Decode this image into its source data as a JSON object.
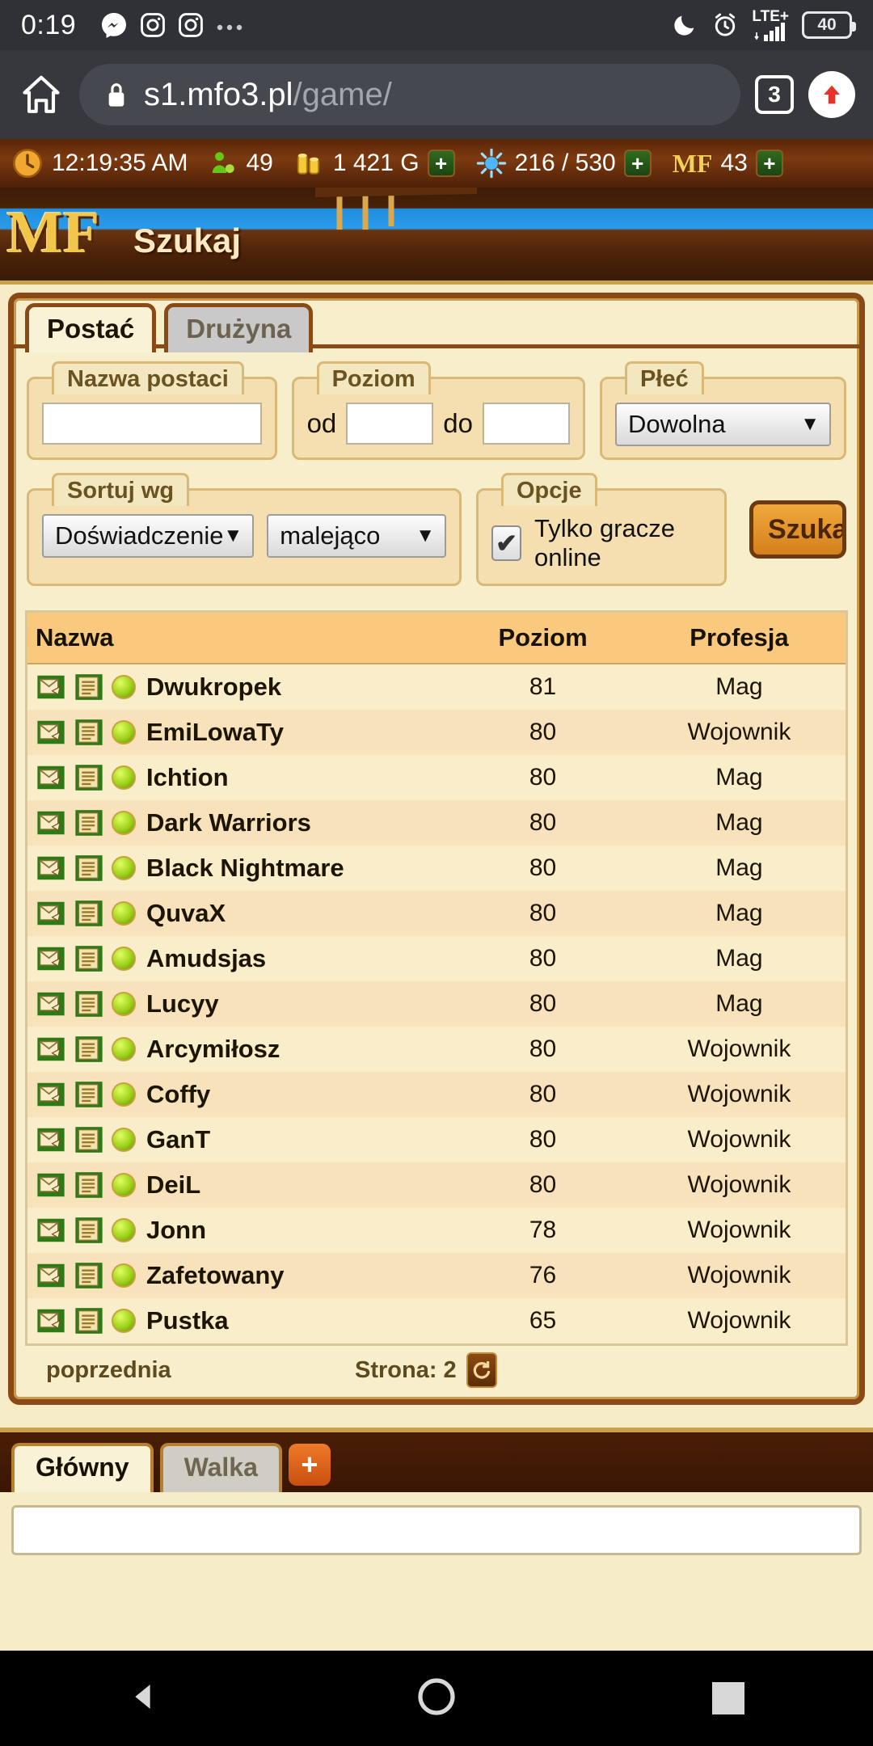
{
  "status_bar": {
    "clock": "0:19",
    "left_icons": [
      "messenger-icon",
      "instagram-icon",
      "instagram-icon",
      "overflow-dots-icon"
    ],
    "right_icons": [
      "moon-icon",
      "alarm-icon",
      "signal-icon"
    ],
    "network_label": "LTE+",
    "battery_level": "40"
  },
  "browser": {
    "home_icon": "home-icon",
    "lock_icon": "lock-icon",
    "url_domain": "s1.mfo3.pl",
    "url_path": "/game/",
    "tab_count": "3",
    "scroll_top_icon": "arrow-up-icon"
  },
  "resource_bar": {
    "clock_icon": "clock-icon",
    "game_time": "12:19:35 AM",
    "online_icon": "players-online-icon",
    "online_count": "49",
    "gold_icon": "gold-coins-icon",
    "gold": "1 421 G",
    "energy_icon": "energy-icon",
    "energy": "216 / 530",
    "mf_label": "MF",
    "mf_value": "43",
    "plus_label": "+"
  },
  "banner": {
    "logo": "MF",
    "title": "Szukaj"
  },
  "search_panel": {
    "tabs": [
      {
        "label": "Postać",
        "active": true
      },
      {
        "label": "Drużyna",
        "active": false
      }
    ],
    "name_field": {
      "legend": "Nazwa postaci",
      "value": "",
      "placeholder": ""
    },
    "level_field": {
      "legend": "Poziom",
      "from_label": "od",
      "from_value": "",
      "to_label": "do",
      "to_value": ""
    },
    "gender_field": {
      "legend": "Płeć",
      "selected": "Dowolna",
      "caret": "▼"
    },
    "sort_field": {
      "legend": "Sortuj wg",
      "by_selected": "Doświadczenie",
      "dir_selected": "malejąco",
      "caret": "▼"
    },
    "options_field": {
      "legend": "Opcje",
      "checkbox_label": "Tylko gracze online",
      "checkbox_checked": true,
      "check_glyph": "✔"
    },
    "search_button": "Szukaj"
  },
  "results": {
    "columns": [
      "Nazwa",
      "Poziom",
      "Profesja"
    ],
    "row_icons": [
      "mail-icon",
      "profile-icon",
      "online-dot-icon"
    ],
    "rows": [
      {
        "name": "Dwukropek",
        "level": "81",
        "profession": "Mag"
      },
      {
        "name": "EmiLowaTy",
        "level": "80",
        "profession": "Wojownik"
      },
      {
        "name": "Ichtion",
        "level": "80",
        "profession": "Mag"
      },
      {
        "name": "Dark Warriors",
        "level": "80",
        "profession": "Mag"
      },
      {
        "name": "Black Nightmare",
        "level": "80",
        "profession": "Mag"
      },
      {
        "name": "QuvaX",
        "level": "80",
        "profession": "Mag"
      },
      {
        "name": "Amudsjas",
        "level": "80",
        "profession": "Mag"
      },
      {
        "name": "Lucyy",
        "level": "80",
        "profession": "Mag"
      },
      {
        "name": "Arcymiłosz",
        "level": "80",
        "profession": "Wojownik"
      },
      {
        "name": "Coffy",
        "level": "80",
        "profession": "Wojownik"
      },
      {
        "name": "GanT",
        "level": "80",
        "profession": "Wojownik"
      },
      {
        "name": "DeiL",
        "level": "80",
        "profession": "Wojownik"
      },
      {
        "name": "Jonn",
        "level": "78",
        "profession": "Wojownik"
      },
      {
        "name": "Zafetowany",
        "level": "76",
        "profession": "Wojownik"
      },
      {
        "name": "Pustka",
        "level": "65",
        "profession": "Wojownik"
      }
    ],
    "pager": {
      "previous": "poprzednia",
      "page_label": "Strona: 2",
      "refresh_icon": "refresh-icon"
    }
  },
  "chat": {
    "tabs": [
      {
        "label": "Główny",
        "active": true
      },
      {
        "label": "Walka",
        "active": false
      }
    ],
    "add_tab_label": "+",
    "input_value": "",
    "input_placeholder": ""
  },
  "nav_bar": {
    "back_icon": "triangle-back-icon",
    "home_icon": "circle-home-icon",
    "recents_icon": "square-recents-icon"
  },
  "colors": {
    "wood_dark": "#4a2209",
    "parchment": "#f6ecc8",
    "header_amber": "#fac97e",
    "accent_orange": "#ef7a28",
    "gold": "#f2c64a"
  }
}
